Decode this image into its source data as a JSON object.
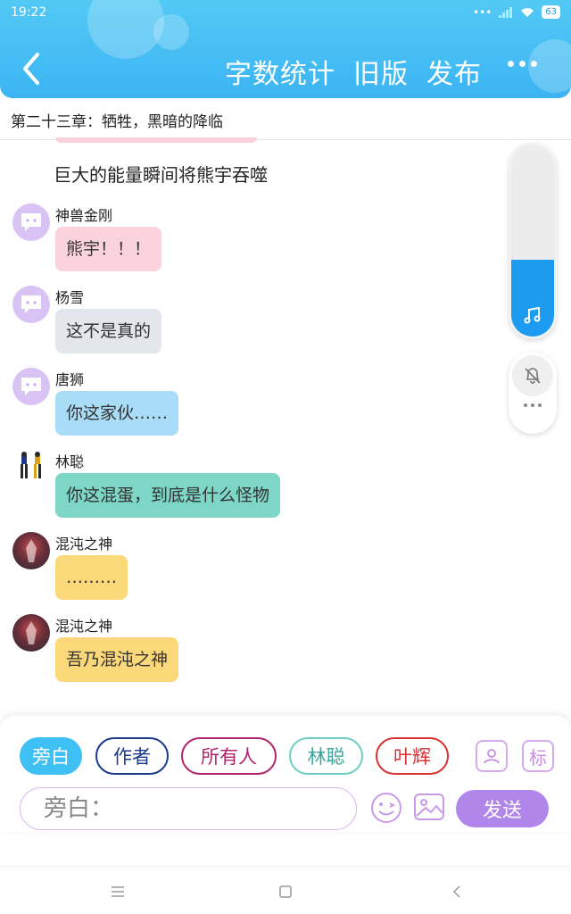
{
  "status_bar": {
    "time": "19:22",
    "battery": "63"
  },
  "header": {
    "actions": [
      "字数统计",
      "旧版",
      "发布"
    ]
  },
  "chapter": {
    "title": "第二十三章：牺牲，黑暗的降临"
  },
  "narration": "巨大的能量瞬间将熊宇吞噬",
  "messages": [
    {
      "speaker": "神兽金刚",
      "text": "熊宇！！！",
      "bubble_color": "#fbd3dd",
      "avatar": "default"
    },
    {
      "speaker": "杨雪",
      "text": "这不是真的",
      "bubble_color": "#e3e6ec",
      "avatar": "default"
    },
    {
      "speaker": "唐狮",
      "text": "你这家伙……",
      "bubble_color": "#a9dcf7",
      "avatar": "default"
    },
    {
      "speaker": "林聪",
      "text": "你这混蛋，到底是什么怪物",
      "bubble_color": "#7dd6c6",
      "avatar": "figures"
    },
    {
      "speaker": "混沌之神",
      "text": "………",
      "bubble_color": "#fbd97a",
      "avatar": "chaos"
    },
    {
      "speaker": "混沌之神",
      "text": "吾乃混沌之神",
      "bubble_color": "#fbd97a",
      "avatar": "chaos"
    }
  ],
  "separator": "……………………………………………………………………",
  "volume": {
    "level": 0.4
  },
  "roles": [
    {
      "label": "旁白",
      "color": "#ffffff",
      "border": "#3fc0f4",
      "bg": "#3fc0f4",
      "selected": true
    },
    {
      "label": "作者",
      "color": "#1a3b8c",
      "border": "#1a3b8c",
      "bg": "#ffffff",
      "selected": false
    },
    {
      "label": "所有人",
      "color": "#b0246b",
      "border": "#b0246b",
      "bg": "#ffffff",
      "selected": false
    },
    {
      "label": "林聪",
      "color": "#3aa79a",
      "border": "#6ccfc2",
      "bg": "#ffffff",
      "selected": false
    },
    {
      "label": "叶辉",
      "color": "#d93232",
      "border": "#d93232",
      "bg": "#ffffff",
      "selected": false
    }
  ],
  "tag_button_label": "标",
  "input": {
    "placeholder": "旁白："
  },
  "send_label": "发送",
  "icons": [
    "back-icon",
    "more-icon",
    "music-icon",
    "mute-bell-icon",
    "role-icon",
    "emoji-icon",
    "image-icon",
    "menu-icon",
    "home-icon",
    "nav-back-icon"
  ]
}
